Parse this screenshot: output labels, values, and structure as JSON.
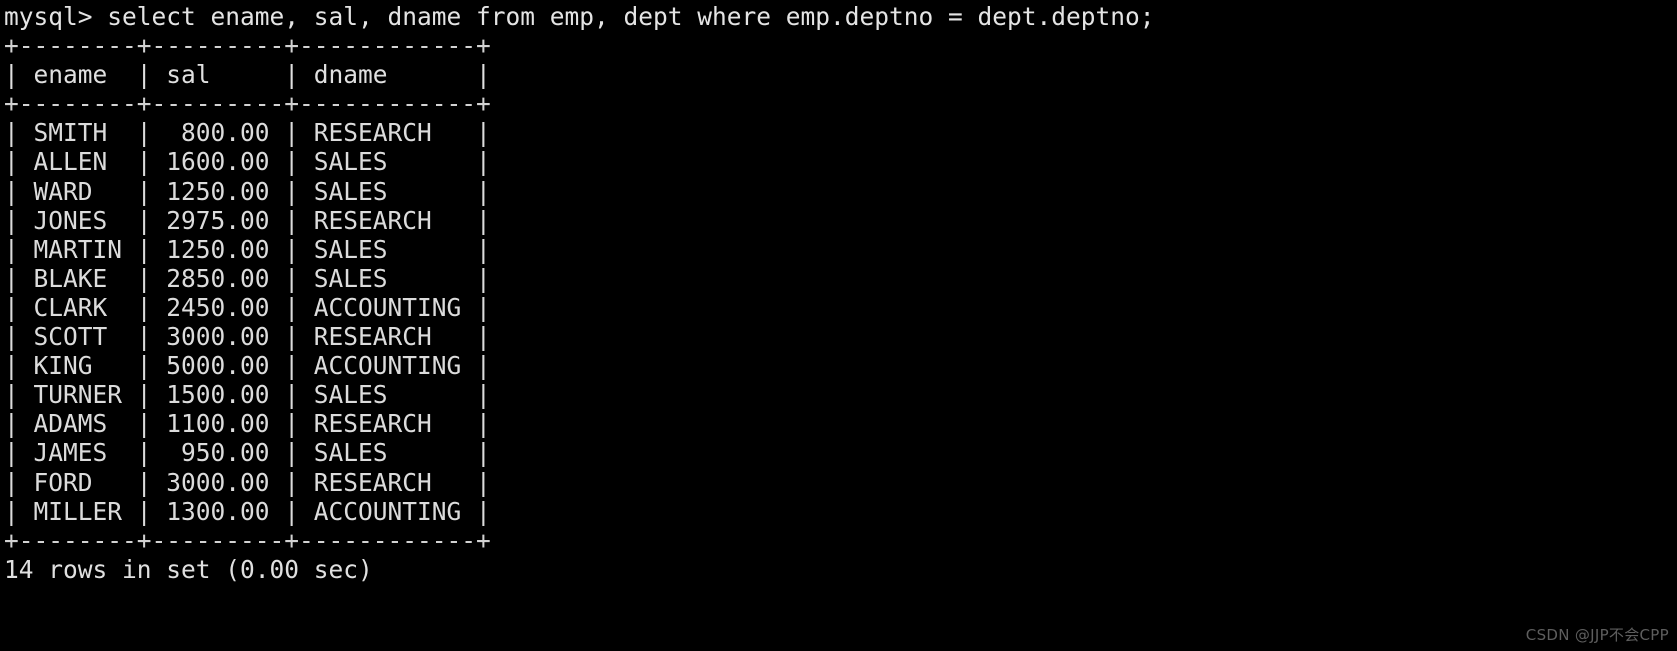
{
  "terminal": {
    "prompt": "mysql> ",
    "query": "select ename, sal, dname from emp, dept where emp.deptno = dept.deptno;",
    "prompt_line": "mysql> select ename, sal, dname from emp, dept where emp.deptno = dept.deptno;",
    "separator": "+--------+---------+------------+",
    "header_row": "| ename  | sal     | dname      |",
    "status": "14 rows in set (0.00 sec)",
    "row_count": 14,
    "duration": "0.00 sec",
    "columns": [
      {
        "name": "ename",
        "width": 8,
        "align": "left"
      },
      {
        "name": "sal",
        "width": 9,
        "align": "right"
      },
      {
        "name": "dname",
        "width": 12,
        "align": "left"
      }
    ],
    "rows": [
      {
        "ename": "SMITH",
        "sal": "800.00",
        "dname": "RESEARCH",
        "line": "| SMITH  |  800.00 | RESEARCH   |"
      },
      {
        "ename": "ALLEN",
        "sal": "1600.00",
        "dname": "SALES",
        "line": "| ALLEN  | 1600.00 | SALES      |"
      },
      {
        "ename": "WARD",
        "sal": "1250.00",
        "dname": "SALES",
        "line": "| WARD   | 1250.00 | SALES      |"
      },
      {
        "ename": "JONES",
        "sal": "2975.00",
        "dname": "RESEARCH",
        "line": "| JONES  | 2975.00 | RESEARCH   |"
      },
      {
        "ename": "MARTIN",
        "sal": "1250.00",
        "dname": "SALES",
        "line": "| MARTIN | 1250.00 | SALES      |"
      },
      {
        "ename": "BLAKE",
        "sal": "2850.00",
        "dname": "SALES",
        "line": "| BLAKE  | 2850.00 | SALES      |"
      },
      {
        "ename": "CLARK",
        "sal": "2450.00",
        "dname": "ACCOUNTING",
        "line": "| CLARK  | 2450.00 | ACCOUNTING |"
      },
      {
        "ename": "SCOTT",
        "sal": "3000.00",
        "dname": "RESEARCH",
        "line": "| SCOTT  | 3000.00 | RESEARCH   |"
      },
      {
        "ename": "KING",
        "sal": "5000.00",
        "dname": "ACCOUNTING",
        "line": "| KING   | 5000.00 | ACCOUNTING |"
      },
      {
        "ename": "TURNER",
        "sal": "1500.00",
        "dname": "SALES",
        "line": "| TURNER | 1500.00 | SALES      |"
      },
      {
        "ename": "ADAMS",
        "sal": "1100.00",
        "dname": "RESEARCH",
        "line": "| ADAMS  | 1100.00 | RESEARCH   |"
      },
      {
        "ename": "JAMES",
        "sal": "950.00",
        "dname": "SALES",
        "line": "| JAMES  |  950.00 | SALES      |"
      },
      {
        "ename": "FORD",
        "sal": "3000.00",
        "dname": "RESEARCH",
        "line": "| FORD   | 3000.00 | RESEARCH   |"
      },
      {
        "ename": "MILLER",
        "sal": "1300.00",
        "dname": "ACCOUNTING",
        "line": "| MILLER | 1300.00 | ACCOUNTING |"
      }
    ]
  },
  "watermark": {
    "text": "CSDN @JJP不会CPP"
  },
  "colors": {
    "background": "#000000",
    "foreground": "#dcdcdc",
    "watermark": "#5e5e5e"
  }
}
